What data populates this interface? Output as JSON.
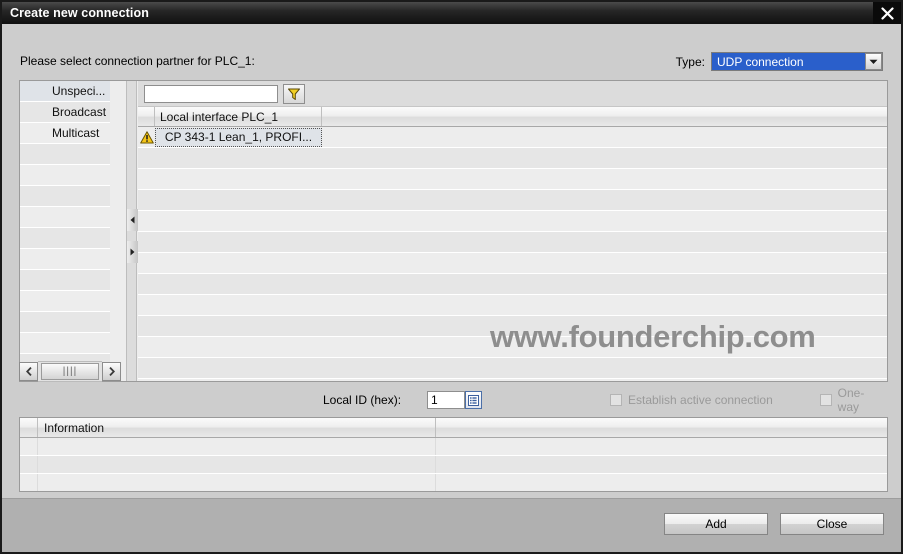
{
  "window": {
    "title": "Create new connection",
    "close_icon": "close-icon"
  },
  "header": {
    "prompt": "Please select connection partner for PLC_1:",
    "type_label": "Type:",
    "type_value": "UDP connection",
    "type_options": [
      "UDP connection"
    ]
  },
  "partner_list": {
    "items": [
      {
        "label": "Unspeci...",
        "selected": true
      },
      {
        "label": "Broadcast",
        "selected": false
      },
      {
        "label": "Multicast",
        "selected": false
      }
    ],
    "scroll_left_icon": "chevron-left-icon",
    "scroll_right_icon": "chevron-right-icon",
    "grip": "||||"
  },
  "interface_table": {
    "filter_placeholder": "",
    "filter_value": "",
    "filter_icon": "funnel-filter-icon",
    "column_header": "Local interface PLC_1",
    "rows": [
      {
        "icon": "warning-triangle-icon",
        "label": "CP 343-1 Lean_1, PROFI...",
        "selected": true
      }
    ]
  },
  "watermark": {
    "text": "www.founderchip.com"
  },
  "options": {
    "local_id_label": "Local ID (hex):",
    "local_id_value": "1",
    "local_id_button_icon": "list-picker-icon",
    "establish_active_label": "Establish active connection",
    "establish_active_checked": false,
    "establish_active_disabled": true,
    "one_way_label": "One-way",
    "one_way_checked": false,
    "one_way_disabled": true
  },
  "information": {
    "column_header": "Information",
    "rows": [
      "",
      "",
      ""
    ]
  },
  "footer": {
    "add_label": "Add",
    "close_label": "Close"
  },
  "colors": {
    "titlebar": "#101010",
    "accent_select": "#2a5fcb",
    "panel_bg": "#ededed",
    "dialog_bg": "#cdcdcd",
    "footer_bg": "#b0b0b0",
    "warning": "#f5c518",
    "watermark": "#8e8e8e"
  }
}
